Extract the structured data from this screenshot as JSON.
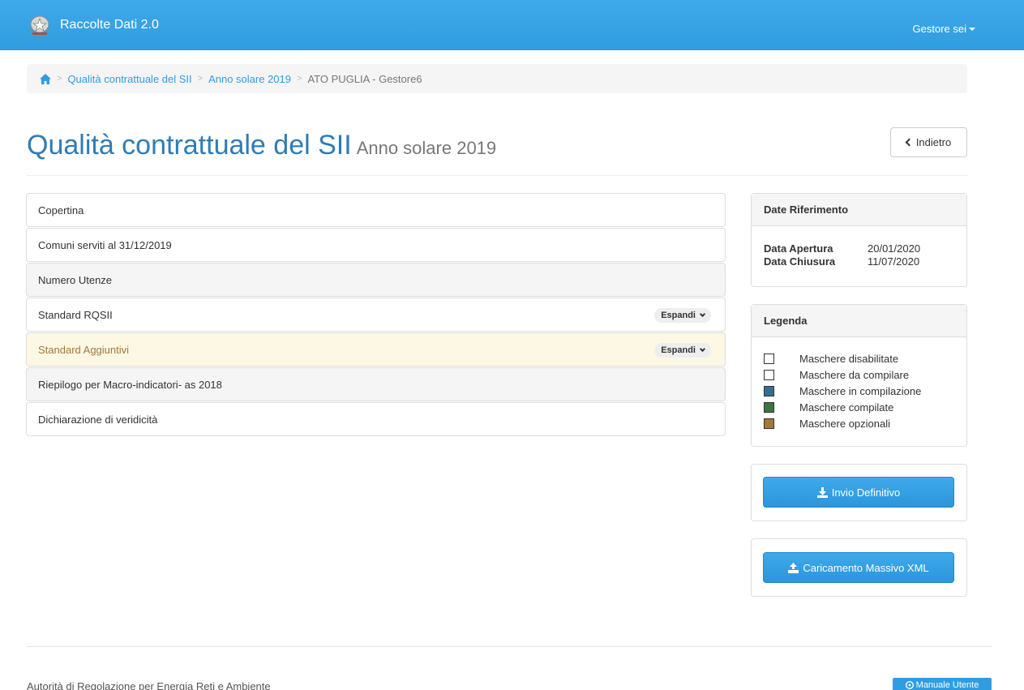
{
  "app": {
    "title": "Raccolte Dati 2.0",
    "user_menu": "Gestore sei"
  },
  "breadcrumb": {
    "items": [
      "Qualità contrattuale del SII",
      "Anno solare 2019"
    ],
    "active": "ATO PUGLIA - Gestore6",
    "separator": ">"
  },
  "header": {
    "title": "Qualità contrattuale del SII",
    "subtitle": "Anno solare 2019",
    "back_label": "Indietro"
  },
  "sections": [
    {
      "label": "Copertina",
      "style": "white"
    },
    {
      "label": "Comuni serviti al 31/12/2019",
      "style": "white"
    },
    {
      "label": "Numero Utenze",
      "style": "gray"
    },
    {
      "label": "Standard RQSII",
      "style": "white",
      "expand": "Espandi"
    },
    {
      "label": "Standard Aggiuntivi",
      "style": "optional",
      "expand": "Espandi"
    },
    {
      "label": "Riepilogo per Macro-indicatori- as 2018",
      "style": "gray"
    },
    {
      "label": "Dichiarazione di veridicità",
      "style": "white"
    }
  ],
  "dates_panel": {
    "title": "Date Riferimento",
    "rows": [
      {
        "label": "Data Apertura",
        "value": "20/01/2020"
      },
      {
        "label": "Data Chiusura",
        "value": "11/07/2020"
      }
    ]
  },
  "legend_panel": {
    "title": "Legenda",
    "items": [
      {
        "label": "Maschere disabilitate",
        "color": "#ffffff"
      },
      {
        "label": "Maschere da compilare",
        "color": "#ffffff"
      },
      {
        "label": "Maschere in compilazione",
        "color": "#31708f"
      },
      {
        "label": "Maschere compilate",
        "color": "#3c763d"
      },
      {
        "label": "Maschere opzionali",
        "color": "#a2783b"
      }
    ]
  },
  "actions": {
    "submit_label": "Invio Definitivo",
    "upload_label": "Caricamento Massivo XML"
  },
  "footer": {
    "text": "Autorità di Regolazione per Energia Reti e Ambiente",
    "manual_label": "Manuale Utente"
  },
  "colors": {
    "brand": "#2f9de0",
    "title": "#2f7cb5",
    "optional_bg": "#fcf8e3"
  }
}
